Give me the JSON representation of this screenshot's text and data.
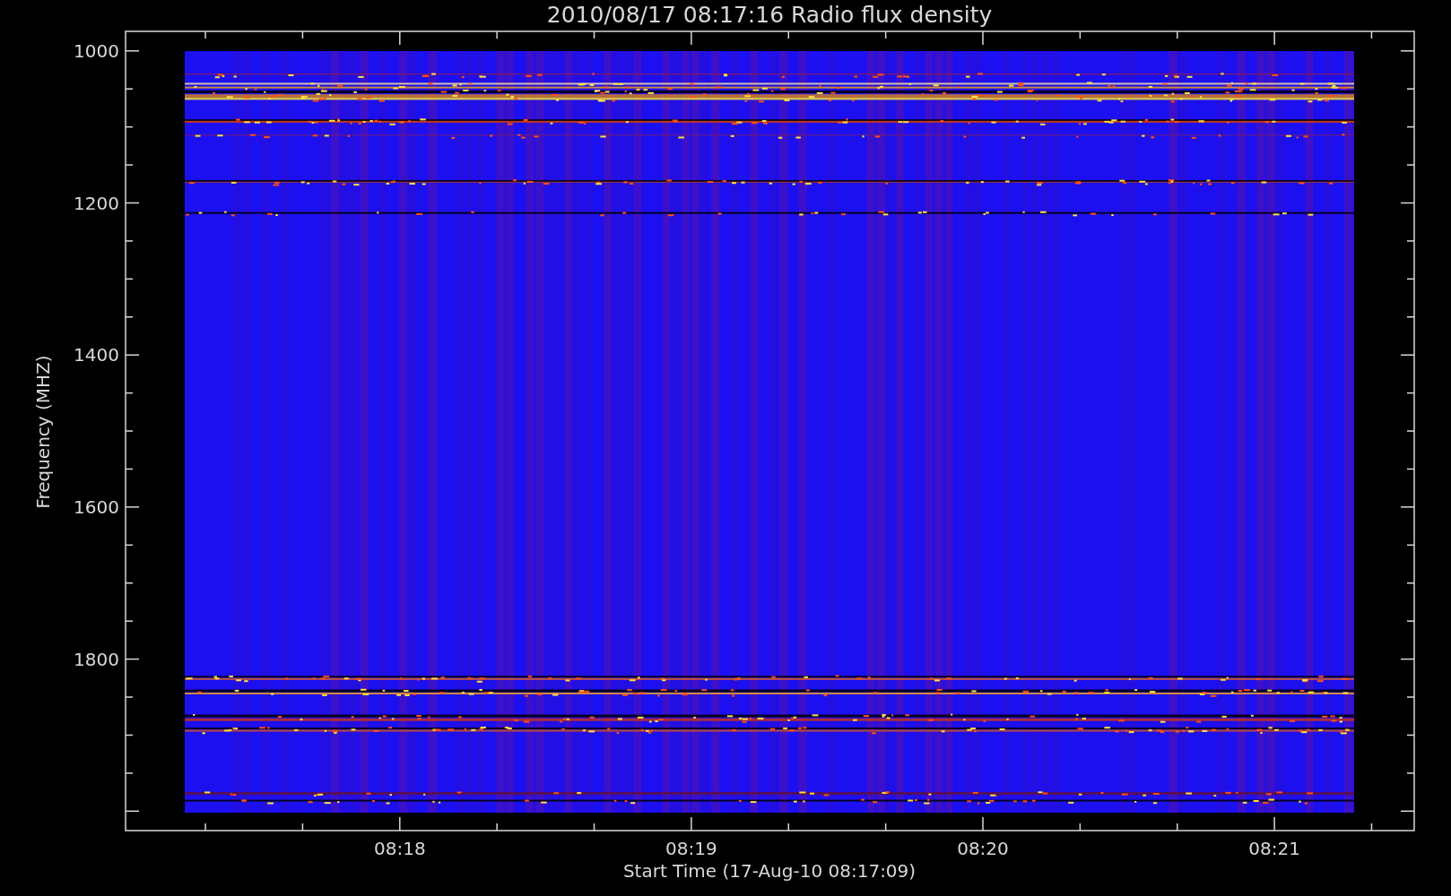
{
  "plot": {
    "title": "2010/08/17 08:17:16 Radio flux density",
    "ylabel": "Frequency (MHZ)",
    "xlabel": "Start Time (17-Aug-10 08:17:09)",
    "yticks": [
      "1000",
      "1200",
      "1400",
      "1600",
      "1800"
    ],
    "xticks": [
      "08:18",
      "08:19",
      "08:20",
      "08:21"
    ]
  }
}
